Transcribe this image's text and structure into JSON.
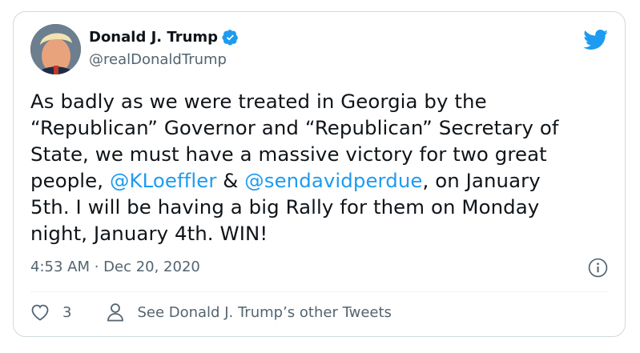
{
  "user": {
    "display_name": "Donald J. Trump",
    "handle": "@realDonaldTrump",
    "verified": true,
    "avatar_icon": "profile-photo"
  },
  "tweet": {
    "lines": [
      [
        {
          "text": "As badly as we were treated in Georgia by the"
        }
      ],
      [
        {
          "text": "“Republican” Governor and “Republican” Secretary of"
        }
      ],
      [
        {
          "text": "State, we must have a massive victory for two great"
        }
      ],
      [
        {
          "text": "people, "
        },
        {
          "text": "@KLoeffler",
          "mention": true
        },
        {
          "text": " & "
        },
        {
          "text": "@sendavidperdue",
          "mention": true
        },
        {
          "text": ", on January"
        }
      ],
      [
        {
          "text": "5th. I will be having a big Rally for them on Monday"
        }
      ],
      [
        {
          "text": "night, January 4th. WIN!"
        }
      ]
    ],
    "timestamp": "4:53 AM · Dec 20, 2020"
  },
  "actions": {
    "like_count": "3",
    "see_more_label": "See Donald J. Trump’s other Tweets"
  },
  "colors": {
    "accent": "#1d9bf0",
    "text": "#0f1419",
    "muted": "#536471",
    "border": "#cfd9de"
  }
}
